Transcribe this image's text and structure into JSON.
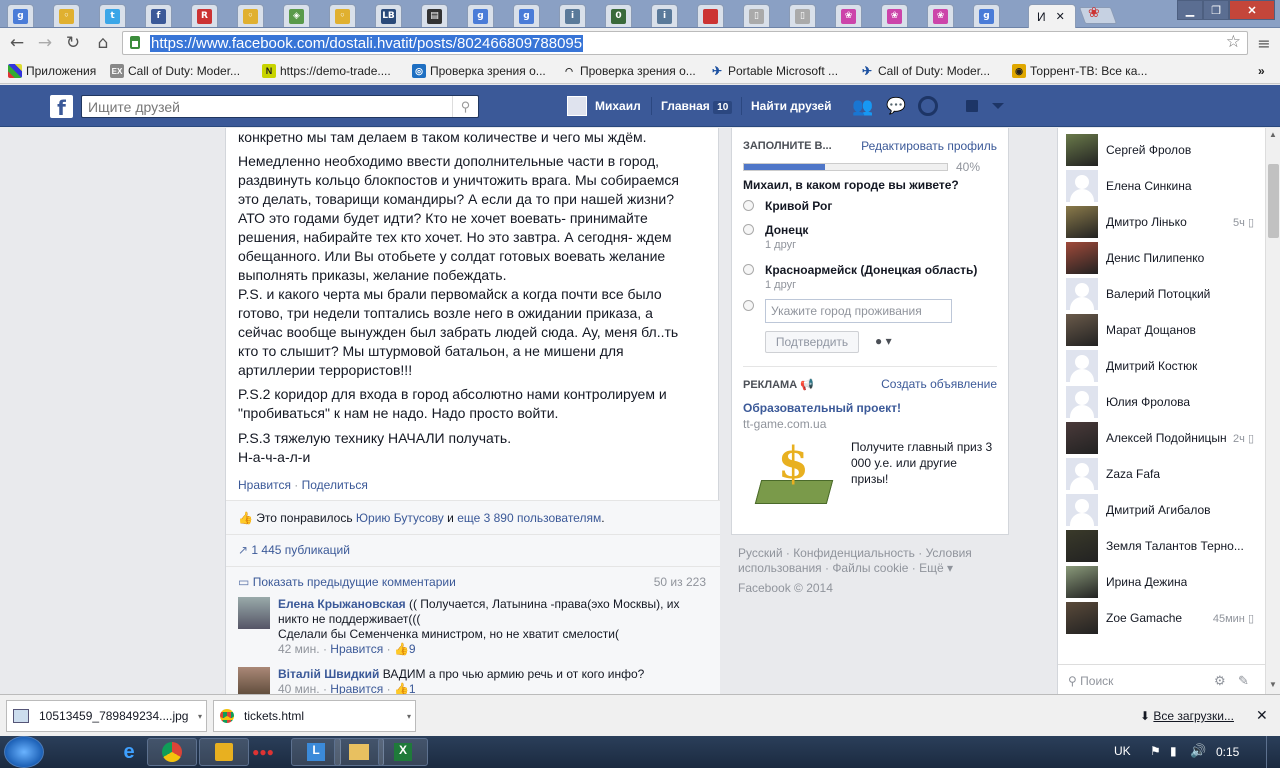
{
  "browser": {
    "active_tab_label": "И",
    "url": "https://www.facebook.com/dostali.hvatit/posts/802466809788095",
    "tab_icons": [
      "g-icon",
      "page-icon",
      "twitter-icon",
      "facebook-icon",
      "red-icon",
      "page-icon",
      "maps-icon",
      "page-icon",
      "lb-icon",
      "clapper-icon",
      "g-icon",
      "g-icon",
      "info-icon",
      "0564-icon",
      "info-icon",
      "red-square-icon",
      "doc-icon",
      "doc-icon",
      "ribbon-icon",
      "ribbon-icon",
      "ribbon-icon",
      "g-icon"
    ],
    "bookmarks": [
      "Приложения",
      "Call of Duty: Moder...",
      "https://demo-trade....",
      "Проверка зрения о...",
      "Проверка зрения о...",
      "Portable Microsoft ...",
      "Call of Duty: Moder...",
      "Торрент-ТВ: Все ка..."
    ]
  },
  "fb": {
    "search_placeholder": "Ищите друзей",
    "user_name": "Михаил",
    "home_label": "Главная",
    "home_count": "10",
    "find_friends": "Найти друзей"
  },
  "post": {
    "p0": "конкретно мы там делаем в таком количестве и чего мы ждём.",
    "p1": [
      "Немедленно необходимо ввести дополнительные части в город,",
      "раздвинуть кольцо блокпостов и уничтожить врага. Мы собираемся",
      "это делать, товарищи командиры? А если да то при нашей жизни?",
      "АТО это годами будет идти? Кто не хочет воевать- принимайте",
      "решения, набирайте тех кто хочет. Но это завтра. А сегодня- ждем",
      "обещанного. Или Вы отобьете у солдат готовых воевать желание",
      "выполнять приказы, желание побеждать.",
      "P.S. и какого черта мы брали первомайск а когда почти все было",
      "готово, три недели топтались возле него в ожидании приказа, а",
      "сейчас вообще вынужден был забрать людей сюда. Ау, меня бл..ть",
      "кто то слышит? Мы штурмовой батальон, а не мишени для",
      "артиллерии террористов!!!"
    ],
    "p2": [
      "P.S.2 коридор для входа в город абсолютно нами контролируем и",
      "\"пробиваться\" к нам не надо. Надо просто войти."
    ],
    "p3": [
      "P.S.3 тяжелую технику НАЧАЛИ получать.",
      "Н-а-ч-а-л-и"
    ],
    "like": "Нравится",
    "share": "Поделиться",
    "likes_prefix": "Это понравилось",
    "likes_name": "Юрию Бутусову",
    "likes_and": "и",
    "likes_more": "еще 3 890 пользователям",
    "shares": "1 445 публикаций",
    "show_prev": "Показать предыдущие комментарии",
    "comment_count": "50 из 223",
    "comments": [
      {
        "author": "Елена Крыжановская",
        "text1": "(( Получается, Латынина -права(эхо Москвы), их",
        "text2": "никто не поддерживает(((",
        "text3": "Сделали бы Семенченка министром, но не хватит смелости(",
        "time": "42 мин.",
        "like": "Нравится",
        "likes": "9"
      },
      {
        "author": "Віталій Швидкий",
        "text1": "ВАДИМ а про чью армию речь и от кого инфо?",
        "time": "40 мин.",
        "like": "Нравится",
        "likes": "1"
      }
    ]
  },
  "profile": {
    "title": "ЗАПОЛНИТЕ В...",
    "edit": "Редактировать профиль",
    "progress_pct": "40%",
    "progress_value": 0.4,
    "question": "Михаил, в каком городе вы живете?",
    "options": [
      {
        "city": "Кривой Рог",
        "sub": ""
      },
      {
        "city": "Донецк",
        "sub": "1 друг"
      },
      {
        "city": "Красноармейск (Донецкая область)",
        "sub": "1 друг"
      }
    ],
    "city_placeholder": "Укажите город проживания",
    "confirm": "Подтвердить"
  },
  "ads": {
    "heading": "РЕКЛАМА",
    "create": "Создать объявление",
    "title": "Образовательный проект!",
    "domain": "tt-game.com.ua",
    "body": [
      "Получите главный приз 3",
      "000 у.е. или другие",
      "призы!"
    ]
  },
  "footer": {
    "line1": "Русский · Конфиденциальность · Условия",
    "line2": "использования · Файлы cookie · Ещё",
    "copyright": "Facebook © 2014"
  },
  "chat": {
    "friends": [
      {
        "name": "Сергей Фролов",
        "time": "",
        "color": "#6a7a4a"
      },
      {
        "name": "Елена Синкина",
        "time": "",
        "color": ""
      },
      {
        "name": "Дмитро Лінько",
        "time": "5ч",
        "color": "#8a7a4a"
      },
      {
        "name": "Денис Пилипенко",
        "time": "",
        "color": "#a04a3a"
      },
      {
        "name": "Валерий Потоцкий",
        "time": "",
        "color": ""
      },
      {
        "name": "Марат Дощанов",
        "time": "",
        "color": "#6a5a4a"
      },
      {
        "name": "Дмитрий Костюк",
        "time": "",
        "color": ""
      },
      {
        "name": "Юлия Фролова",
        "time": "",
        "color": ""
      },
      {
        "name": "Алексей Подойницын",
        "time": "2ч",
        "color": "#4a3a3a"
      },
      {
        "name": "Zaza Fafa",
        "time": "",
        "color": ""
      },
      {
        "name": "Дмитрий Агибалов",
        "time": "",
        "color": ""
      },
      {
        "name": "Земля Талантов Терно...",
        "time": "",
        "color": "#3a3a2a"
      },
      {
        "name": "Ирина Дежина",
        "time": "",
        "color": "#8a9a7a"
      },
      {
        "name": "Zoe Gamache",
        "time": "45мин",
        "color": "#5a4a3a"
      }
    ],
    "search": "Поиск"
  },
  "downloads": {
    "items": [
      "10513459_789849234....jpg",
      "tickets.html"
    ],
    "all": "Все загрузки..."
  },
  "taskbar": {
    "lang": "UK",
    "clock": "0:15"
  }
}
